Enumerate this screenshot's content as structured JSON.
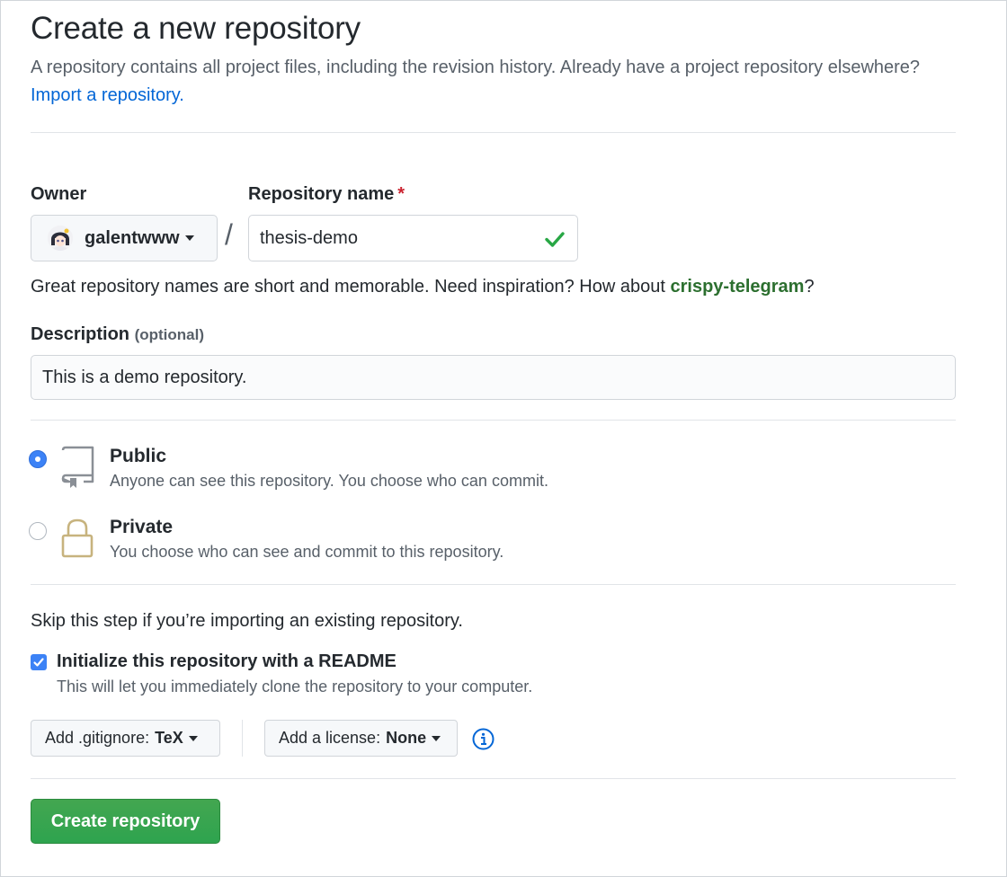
{
  "header": {
    "title": "Create a new repository",
    "subtitle_line1": "A repository contains all project files, including the revision history. Already have a project repository",
    "subtitle_line2": "elsewhere?",
    "import_link": "Import a repository."
  },
  "owner": {
    "label": "Owner",
    "value": "galentwww"
  },
  "repo_name": {
    "label": "Repository name",
    "required_mark": "*",
    "value": "thesis-demo",
    "separator": "/"
  },
  "name_hint": {
    "text": "Great repository names are short and memorable. Need inspiration? How about",
    "suggestion": "crispy-telegram",
    "suffix": "?"
  },
  "description": {
    "label": "Description",
    "optional": "(optional)",
    "value": "This is a demo repository."
  },
  "visibility": {
    "selected": "public",
    "public": {
      "title": "Public",
      "desc": "Anyone can see this repository. You choose who can commit."
    },
    "private": {
      "title": "Private",
      "desc": "You choose who can see and commit to this repository."
    }
  },
  "init": {
    "skip_note": "Skip this step if you’re importing an existing repository.",
    "readme_checked": true,
    "readme_label": "Initialize this repository with a README",
    "readme_desc": "This will let you immediately clone the repository to your computer."
  },
  "gitignore": {
    "label": "Add .gitignore:",
    "value": "TeX"
  },
  "license": {
    "label": "Add a license:",
    "value": "None"
  },
  "submit": {
    "label": "Create repository"
  },
  "colors": {
    "link": "#0366d6",
    "primary_button": "#2ea44f",
    "suggestion": "#2c6f2f",
    "check": "#28a745",
    "radio_selected": "#3c82f6"
  },
  "icons": {
    "public": "repo-book-icon",
    "private": "lock-icon",
    "info": "info-icon",
    "valid": "check-icon"
  }
}
